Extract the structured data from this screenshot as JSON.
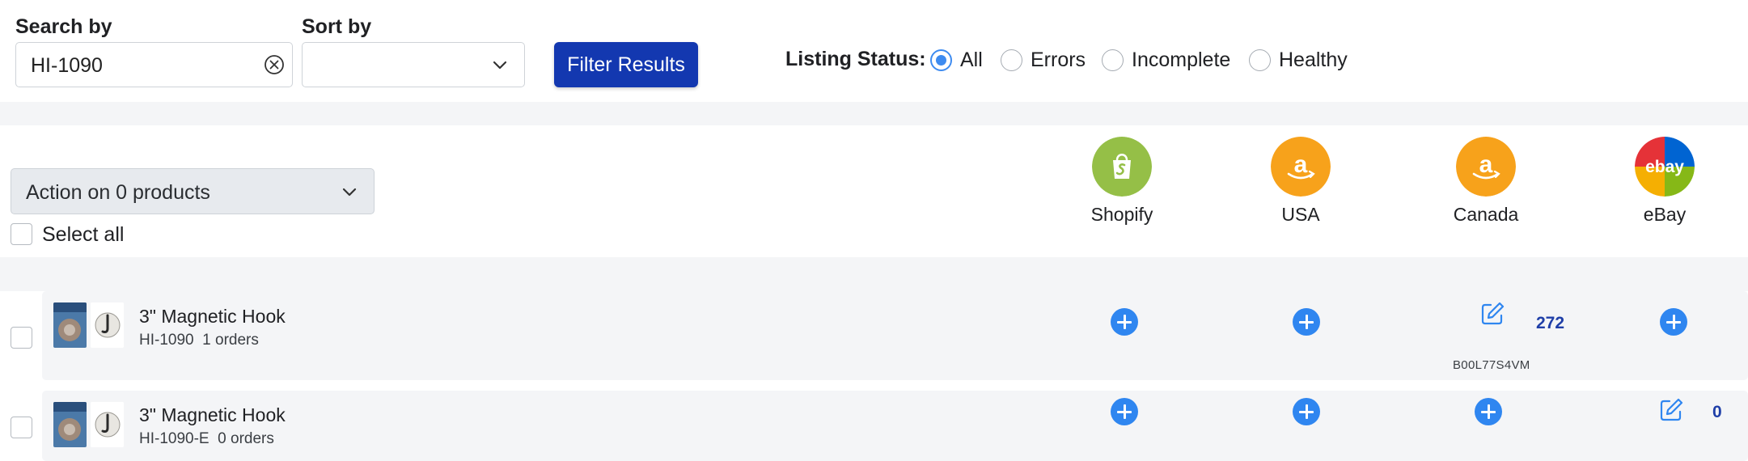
{
  "filters": {
    "search_label": "Search by",
    "search_value": "HI-1090",
    "sort_label": "Sort by",
    "sort_value": "",
    "filter_button": "Filter Results",
    "listing_status_label": "Listing Status:",
    "status_options": [
      {
        "label": "All",
        "selected": true
      },
      {
        "label": "Errors",
        "selected": false
      },
      {
        "label": "Incomplete",
        "selected": false
      },
      {
        "label": "Healthy",
        "selected": false
      }
    ]
  },
  "actions": {
    "action_select": "Action on 0 products",
    "select_all_label": "Select all"
  },
  "channels": [
    {
      "name": "Shopify",
      "icon": "shopify-icon",
      "color": "#95bf47"
    },
    {
      "name": "USA",
      "icon": "amazon-icon",
      "color": "#f7a21b"
    },
    {
      "name": "Canada",
      "icon": "amazon-icon",
      "color": "#f7a21b"
    },
    {
      "name": "eBay",
      "icon": "ebay-icon",
      "color": "#e53238"
    }
  ],
  "products": [
    {
      "title": "3\" Magnetic Hook",
      "sku": "HI-1090",
      "orders": "1 orders",
      "canada_stock": "272",
      "canada_asin": "B00L77S4VM"
    },
    {
      "title": "3\" Magnetic Hook",
      "sku": "HI-1090-E",
      "orders": "0 orders",
      "ebay_stock": "0"
    }
  ],
  "colors": {
    "primary_button": "#1338b0",
    "add_button": "#2f86f0",
    "radio_selected": "#3d8bf0",
    "stock_text": "#1f3fa8",
    "panel_bg": "#f4f5f7"
  }
}
